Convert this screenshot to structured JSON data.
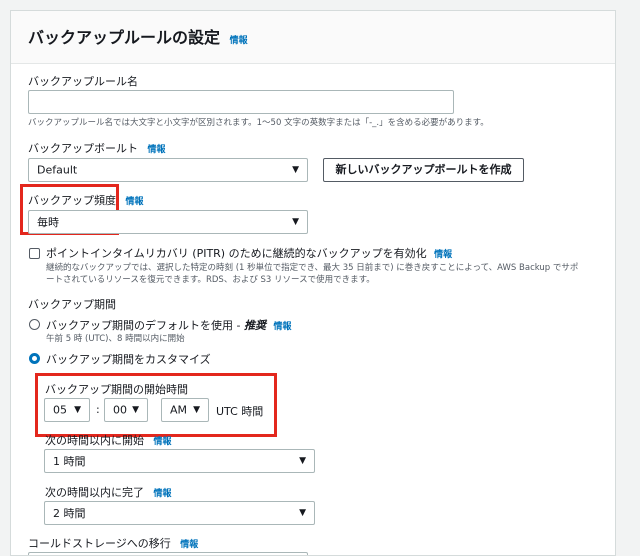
{
  "panel": {
    "title": "バックアップルールの設定",
    "info": "情報"
  },
  "rule_name": {
    "label": "バックアップルール名",
    "value": "",
    "hint": "バックアップルール名では大文字と小文字が区別されます。1〜50 文字の英数字または「-_.」を含める必要があります。"
  },
  "vault": {
    "label": "バックアップボールト",
    "info": "情報",
    "value": "Default",
    "create_button": "新しいバックアップボールトを作成"
  },
  "frequency": {
    "label": "バックアップ頻度",
    "info": "情報",
    "value": "毎時"
  },
  "pitr": {
    "label": "ポイントインタイムリカバリ (PITR) のために継続的なバックアップを有効化",
    "info": "情報",
    "desc1": "継続的なバックアップでは、選択した特定の時刻 (1 秒単位で指定でき、最大 35 日前まで) に巻き戻すことによって、AWS Backup でサポ",
    "desc2": "ートされているリソースを復元できます。RDS、および S3 リソースで使用できます。",
    "checked": false
  },
  "window": {
    "label": "バックアップ期間",
    "default_option": {
      "label": "バックアップ期間のデフォルトを使用 - ",
      "emphasis": "推奨",
      "info": "情報",
      "desc": "午前 5 時 (UTC)、8 時間以内に開始"
    },
    "custom_option": {
      "label": "バックアップ期間をカスタマイズ"
    },
    "selected": "custom",
    "start_time": {
      "label": "バックアップ期間の開始時間",
      "hour": "05",
      "separator": ":",
      "minute": "00",
      "ampm": "AM",
      "tz": "UTC 時間"
    },
    "start_within": {
      "label": "次の時間以内に開始",
      "info": "情報",
      "value": "1 時間"
    },
    "complete_within": {
      "label": "次の時間以内に完了",
      "info": "情報",
      "value": "2 時間"
    }
  },
  "cold_storage": {
    "label": "コールドストレージへの移行",
    "info": "情報"
  },
  "colors": {
    "accent": "#0073bb",
    "highlight": "#e3271d"
  }
}
